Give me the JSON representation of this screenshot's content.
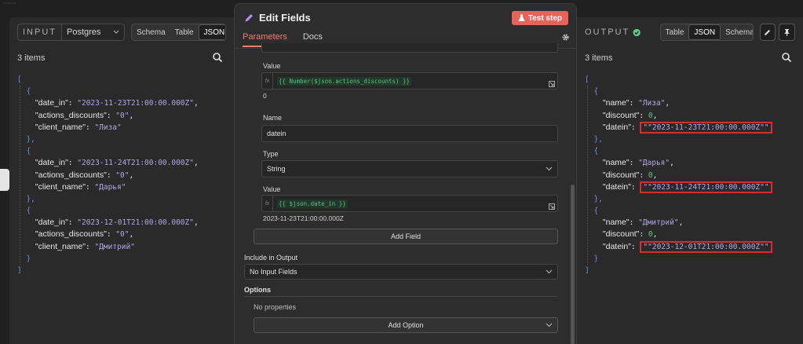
{
  "input_panel": {
    "label": "INPUT",
    "source": "Postgres",
    "view_tabs": [
      "Schema",
      "Table",
      "JSON"
    ],
    "active_tab": "JSON",
    "items_count": "3 items",
    "records": [
      {
        "date_in": "\"2023-11-23T21:00:00.000Z\"",
        "actions_discounts": "\"0\"",
        "client_name": "\"Лиза\""
      },
      {
        "date_in": "\"2023-11-24T21:00:00.000Z\"",
        "actions_discounts": "\"0\"",
        "client_name": "\"Дарья\""
      },
      {
        "date_in": "\"2023-12-01T21:00:00.000Z\"",
        "actions_discounts": "\"0\"",
        "client_name": "\"Дмитрий\""
      }
    ]
  },
  "editor": {
    "title": "Edit Fields",
    "test_button": "Test step",
    "tabs": [
      "Parameters",
      "Docs"
    ],
    "value_label_1": "Value",
    "value_expr_1": "{{ Number($json.actions_discounts) }}",
    "value_result_1": "0",
    "name_label": "Name",
    "name_value": "datein",
    "type_label": "Type",
    "type_value": "String",
    "value_label_2": "Value",
    "value_expr_2": "{{ $json.date_in }}",
    "value_result_2": "2023-11-23T21:00:00.000Z",
    "add_field": "Add Field",
    "include_label": "Include in Output",
    "include_value": "No Input Fields",
    "options_label": "Options",
    "no_props": "No properties",
    "add_option": "Add Option",
    "fx_label": "fx"
  },
  "output_panel": {
    "label": "OUTPUT",
    "view_tabs": [
      "Table",
      "JSON",
      "Schema"
    ],
    "active_tab": "JSON",
    "items_count": "3 items",
    "records": [
      {
        "name": "\"Лиза\"",
        "discount": "0",
        "datein": "\"\"2023-11-23T21:00:00.000Z\"\""
      },
      {
        "name": "\"Дарья\"",
        "discount": "0",
        "datein": "\"\"2023-11-24T21:00:00.000Z\"\""
      },
      {
        "name": "\"Дмитрий\"",
        "discount": "0",
        "datein": "\"\"2023-12-01T21:00:00.000Z\"\""
      }
    ]
  },
  "colors": {
    "accent": "#ef7f74",
    "test_button": "#e8645a",
    "success": "#5ec98a",
    "highlight": "#d32f2f"
  }
}
